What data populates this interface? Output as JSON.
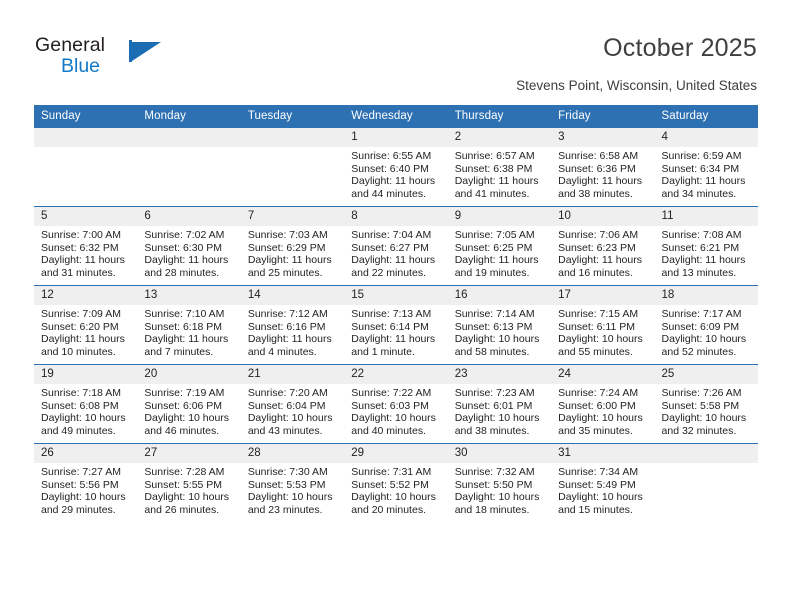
{
  "logo": {
    "word1": "General",
    "word2": "Blue",
    "icon": "triangle-flag-icon"
  },
  "header": {
    "title": "October 2025",
    "location": "Stevens Point, Wisconsin, United States"
  },
  "calendar": {
    "weekday_headers": [
      "Sunday",
      "Monday",
      "Tuesday",
      "Wednesday",
      "Thursday",
      "Friday",
      "Saturday"
    ],
    "accent_color": "#2e71b3",
    "daynum_band_color": "#efefef",
    "weeks": [
      [
        {
          "day": "",
          "empty": true
        },
        {
          "day": "",
          "empty": true
        },
        {
          "day": "",
          "empty": true
        },
        {
          "day": "1",
          "sunrise": "Sunrise: 6:55 AM",
          "sunset": "Sunset: 6:40 PM",
          "daylight1": "Daylight: 11 hours",
          "daylight2": "and 44 minutes."
        },
        {
          "day": "2",
          "sunrise": "Sunrise: 6:57 AM",
          "sunset": "Sunset: 6:38 PM",
          "daylight1": "Daylight: 11 hours",
          "daylight2": "and 41 minutes."
        },
        {
          "day": "3",
          "sunrise": "Sunrise: 6:58 AM",
          "sunset": "Sunset: 6:36 PM",
          "daylight1": "Daylight: 11 hours",
          "daylight2": "and 38 minutes."
        },
        {
          "day": "4",
          "sunrise": "Sunrise: 6:59 AM",
          "sunset": "Sunset: 6:34 PM",
          "daylight1": "Daylight: 11 hours",
          "daylight2": "and 34 minutes."
        }
      ],
      [
        {
          "day": "5",
          "sunrise": "Sunrise: 7:00 AM",
          "sunset": "Sunset: 6:32 PM",
          "daylight1": "Daylight: 11 hours",
          "daylight2": "and 31 minutes."
        },
        {
          "day": "6",
          "sunrise": "Sunrise: 7:02 AM",
          "sunset": "Sunset: 6:30 PM",
          "daylight1": "Daylight: 11 hours",
          "daylight2": "and 28 minutes."
        },
        {
          "day": "7",
          "sunrise": "Sunrise: 7:03 AM",
          "sunset": "Sunset: 6:29 PM",
          "daylight1": "Daylight: 11 hours",
          "daylight2": "and 25 minutes."
        },
        {
          "day": "8",
          "sunrise": "Sunrise: 7:04 AM",
          "sunset": "Sunset: 6:27 PM",
          "daylight1": "Daylight: 11 hours",
          "daylight2": "and 22 minutes."
        },
        {
          "day": "9",
          "sunrise": "Sunrise: 7:05 AM",
          "sunset": "Sunset: 6:25 PM",
          "daylight1": "Daylight: 11 hours",
          "daylight2": "and 19 minutes."
        },
        {
          "day": "10",
          "sunrise": "Sunrise: 7:06 AM",
          "sunset": "Sunset: 6:23 PM",
          "daylight1": "Daylight: 11 hours",
          "daylight2": "and 16 minutes."
        },
        {
          "day": "11",
          "sunrise": "Sunrise: 7:08 AM",
          "sunset": "Sunset: 6:21 PM",
          "daylight1": "Daylight: 11 hours",
          "daylight2": "and 13 minutes."
        }
      ],
      [
        {
          "day": "12",
          "sunrise": "Sunrise: 7:09 AM",
          "sunset": "Sunset: 6:20 PM",
          "daylight1": "Daylight: 11 hours",
          "daylight2": "and 10 minutes."
        },
        {
          "day": "13",
          "sunrise": "Sunrise: 7:10 AM",
          "sunset": "Sunset: 6:18 PM",
          "daylight1": "Daylight: 11 hours",
          "daylight2": "and 7 minutes."
        },
        {
          "day": "14",
          "sunrise": "Sunrise: 7:12 AM",
          "sunset": "Sunset: 6:16 PM",
          "daylight1": "Daylight: 11 hours",
          "daylight2": "and 4 minutes."
        },
        {
          "day": "15",
          "sunrise": "Sunrise: 7:13 AM",
          "sunset": "Sunset: 6:14 PM",
          "daylight1": "Daylight: 11 hours",
          "daylight2": "and 1 minute."
        },
        {
          "day": "16",
          "sunrise": "Sunrise: 7:14 AM",
          "sunset": "Sunset: 6:13 PM",
          "daylight1": "Daylight: 10 hours",
          "daylight2": "and 58 minutes."
        },
        {
          "day": "17",
          "sunrise": "Sunrise: 7:15 AM",
          "sunset": "Sunset: 6:11 PM",
          "daylight1": "Daylight: 10 hours",
          "daylight2": "and 55 minutes."
        },
        {
          "day": "18",
          "sunrise": "Sunrise: 7:17 AM",
          "sunset": "Sunset: 6:09 PM",
          "daylight1": "Daylight: 10 hours",
          "daylight2": "and 52 minutes."
        }
      ],
      [
        {
          "day": "19",
          "sunrise": "Sunrise: 7:18 AM",
          "sunset": "Sunset: 6:08 PM",
          "daylight1": "Daylight: 10 hours",
          "daylight2": "and 49 minutes."
        },
        {
          "day": "20",
          "sunrise": "Sunrise: 7:19 AM",
          "sunset": "Sunset: 6:06 PM",
          "daylight1": "Daylight: 10 hours",
          "daylight2": "and 46 minutes."
        },
        {
          "day": "21",
          "sunrise": "Sunrise: 7:20 AM",
          "sunset": "Sunset: 6:04 PM",
          "daylight1": "Daylight: 10 hours",
          "daylight2": "and 43 minutes."
        },
        {
          "day": "22",
          "sunrise": "Sunrise: 7:22 AM",
          "sunset": "Sunset: 6:03 PM",
          "daylight1": "Daylight: 10 hours",
          "daylight2": "and 40 minutes."
        },
        {
          "day": "23",
          "sunrise": "Sunrise: 7:23 AM",
          "sunset": "Sunset: 6:01 PM",
          "daylight1": "Daylight: 10 hours",
          "daylight2": "and 38 minutes."
        },
        {
          "day": "24",
          "sunrise": "Sunrise: 7:24 AM",
          "sunset": "Sunset: 6:00 PM",
          "daylight1": "Daylight: 10 hours",
          "daylight2": "and 35 minutes."
        },
        {
          "day": "25",
          "sunrise": "Sunrise: 7:26 AM",
          "sunset": "Sunset: 5:58 PM",
          "daylight1": "Daylight: 10 hours",
          "daylight2": "and 32 minutes."
        }
      ],
      [
        {
          "day": "26",
          "sunrise": "Sunrise: 7:27 AM",
          "sunset": "Sunset: 5:56 PM",
          "daylight1": "Daylight: 10 hours",
          "daylight2": "and 29 minutes."
        },
        {
          "day": "27",
          "sunrise": "Sunrise: 7:28 AM",
          "sunset": "Sunset: 5:55 PM",
          "daylight1": "Daylight: 10 hours",
          "daylight2": "and 26 minutes."
        },
        {
          "day": "28",
          "sunrise": "Sunrise: 7:30 AM",
          "sunset": "Sunset: 5:53 PM",
          "daylight1": "Daylight: 10 hours",
          "daylight2": "and 23 minutes."
        },
        {
          "day": "29",
          "sunrise": "Sunrise: 7:31 AM",
          "sunset": "Sunset: 5:52 PM",
          "daylight1": "Daylight: 10 hours",
          "daylight2": "and 20 minutes."
        },
        {
          "day": "30",
          "sunrise": "Sunrise: 7:32 AM",
          "sunset": "Sunset: 5:50 PM",
          "daylight1": "Daylight: 10 hours",
          "daylight2": "and 18 minutes."
        },
        {
          "day": "31",
          "sunrise": "Sunrise: 7:34 AM",
          "sunset": "Sunset: 5:49 PM",
          "daylight1": "Daylight: 10 hours",
          "daylight2": "and 15 minutes."
        },
        {
          "day": "",
          "empty": true
        }
      ]
    ]
  }
}
